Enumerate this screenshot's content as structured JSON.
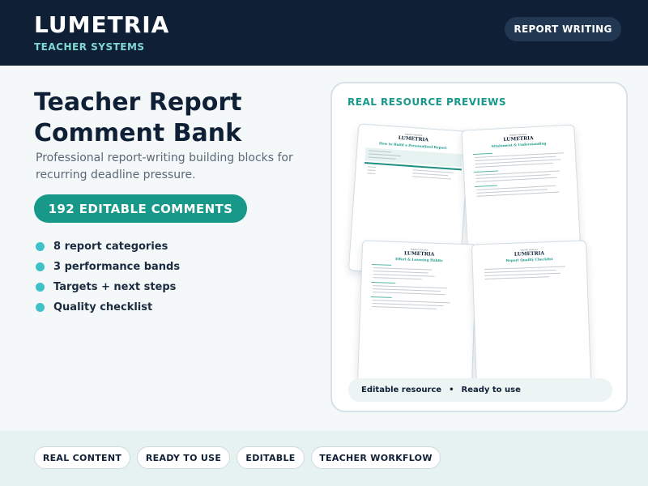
{
  "header": {
    "brand": "LUMETRIA",
    "brand_sub": "TEACHER SYSTEMS",
    "action_label": "REPORT WRITING"
  },
  "main": {
    "title": "Teacher Report Comment Bank",
    "subtitle": "Professional report-writing building blocks for recurring deadline pressure.",
    "badge": "192 EDITABLE COMMENTS",
    "features": [
      "8 report categories",
      "3 performance bands",
      "Targets + next steps",
      "Quality checklist"
    ]
  },
  "preview": {
    "heading": "REAL RESOURCE PREVIEWS",
    "docs": [
      {
        "brand": "LUMETRIA",
        "title": "How to Build a Personalised Report"
      },
      {
        "brand": "LUMETRIA",
        "title": "Attainment & Understanding"
      },
      {
        "brand": "LUMETRIA",
        "title": "Effort & Learning Habits"
      },
      {
        "brand": "LUMETRIA",
        "title": "Report Quality Checklist"
      }
    ],
    "footer_left": "Editable resource",
    "footer_sep": "•",
    "footer_right": "Ready to use"
  },
  "tags": [
    "REAL CONTENT",
    "READY TO USE",
    "EDITABLE",
    "TEACHER WORKFLOW"
  ],
  "colors": {
    "header_bg": "#0f1f36",
    "accent_teal": "#179889",
    "bullet": "#3ec1c9",
    "bottom_bg": "#e6f2ef"
  }
}
